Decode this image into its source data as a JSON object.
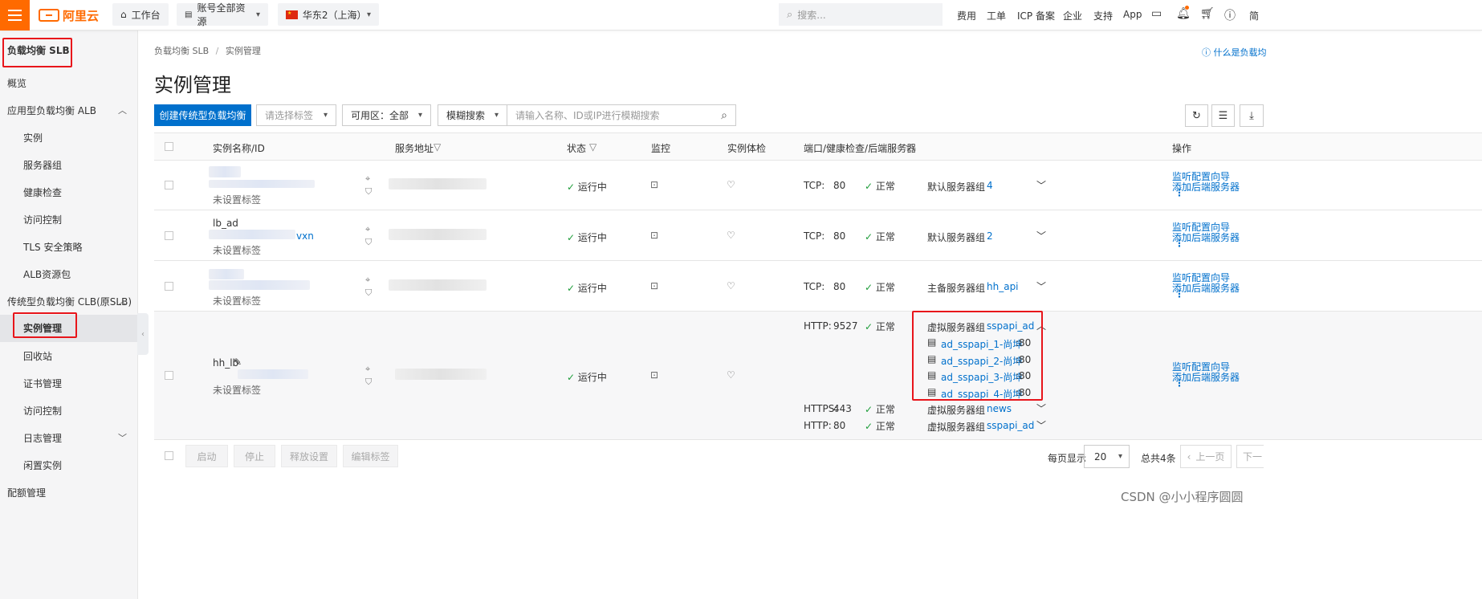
{
  "topbar": {
    "logo_text": "阿里云",
    "workbench": "工作台",
    "account_resources": "账号全部资源",
    "region": "华东2（上海）",
    "search_placeholder": "搜索...",
    "links": [
      "费用",
      "工单",
      "ICP 备案",
      "企业",
      "支持",
      "App"
    ],
    "lang": "简"
  },
  "sidebar": {
    "title": "负载均衡 SLB",
    "items": [
      {
        "label": "概览",
        "kind": "group"
      },
      {
        "label": "应用型负载均衡 ALB",
        "kind": "group",
        "chevron": "^"
      },
      {
        "label": "实例",
        "kind": "sub"
      },
      {
        "label": "服务器组",
        "kind": "sub"
      },
      {
        "label": "健康检查",
        "kind": "sub"
      },
      {
        "label": "访问控制",
        "kind": "sub"
      },
      {
        "label": "TLS 安全策略",
        "kind": "sub"
      },
      {
        "label": "ALB资源包",
        "kind": "sub"
      },
      {
        "label": "传统型负载均衡 CLB(原SLB)",
        "kind": "group",
        "chevron": "^"
      },
      {
        "label": "实例管理",
        "kind": "sub",
        "active": true
      },
      {
        "label": "回收站",
        "kind": "sub"
      },
      {
        "label": "证书管理",
        "kind": "sub"
      },
      {
        "label": "访问控制",
        "kind": "sub"
      },
      {
        "label": "日志管理",
        "kind": "sub",
        "chevron": "v"
      },
      {
        "label": "闲置实例",
        "kind": "sub"
      },
      {
        "label": "配额管理",
        "kind": "group"
      }
    ]
  },
  "main": {
    "breadcrumb_root": "负载均衡 SLB",
    "breadcrumb_sep": "/",
    "breadcrumb_current": "实例管理",
    "help_link": "什么是负载均",
    "page_title": "实例管理",
    "create_button": "创建传统型负载均衡",
    "tag_select_placeholder": "请选择标签",
    "zone_select": "可用区：全部",
    "search_mode": "模糊搜索",
    "search_placeholder": "请输入名称、ID或IP进行模糊搜索"
  },
  "table": {
    "headers": {
      "name": "实例名称/ID",
      "address": "服务地址",
      "status": "状态",
      "monitor": "监控",
      "health": "实例体检",
      "ports": "端口/健康检查/后端服务器",
      "actions": "操作"
    },
    "rows": [
      {
        "name": "",
        "name_suffix": "",
        "tag": "未设置标签",
        "status": "运行中",
        "listeners": [
          {
            "protocol": "TCP:",
            "port": "80",
            "health": "正常",
            "group_type": "默认服务器组",
            "group": "4"
          }
        ],
        "actions": [
          "监听配置向导",
          "添加后端服务器"
        ]
      },
      {
        "name": "lb_ad",
        "name_suffix": "vxn",
        "tag": "未设置标签",
        "status": "运行中",
        "listeners": [
          {
            "protocol": "TCP:",
            "port": "80",
            "health": "正常",
            "group_type": "默认服务器组",
            "group": "2"
          }
        ],
        "actions": [
          "监听配置向导",
          "添加后端服务器"
        ]
      },
      {
        "name": "",
        "name_suffix": "",
        "tag": "未设置标签",
        "status": "运行中",
        "listeners": [
          {
            "protocol": "TCP:",
            "port": "80",
            "health": "正常",
            "group_type": "主备服务器组",
            "group": "hh_api"
          }
        ],
        "actions": [
          "监听配置向导",
          "添加后端服务器"
        ]
      },
      {
        "name": "hh_lb",
        "name_suffix": "",
        "tag": "未设置标签",
        "status": "运行中",
        "listeners": [
          {
            "protocol": "HTTP:",
            "port": "9527",
            "health": "正常",
            "group_type": "虚拟服务器组",
            "group": "sspapi_ad",
            "servers": [
              {
                "name": "ad_sspapi_1-尚坤",
                "port": ":80"
              },
              {
                "name": "ad_sspapi_2-尚坤",
                "port": ":80"
              },
              {
                "name": "ad_sspapi_3-尚坤",
                "port": ":80"
              },
              {
                "name": "ad_sspapi_4-尚坤",
                "port": ":80"
              }
            ]
          },
          {
            "protocol": "HTTPS:",
            "port": "443",
            "health": "正常",
            "group_type": "虚拟服务器组",
            "group": "news"
          },
          {
            "protocol": "HTTP:",
            "port": "80",
            "health": "正常",
            "group_type": "虚拟服务器组",
            "group": "sspapi_ad"
          }
        ],
        "actions": [
          "监听配置向导",
          "添加后端服务器"
        ]
      }
    ]
  },
  "footer": {
    "bulk_buttons": [
      "启动",
      "停止",
      "释放设置",
      "编辑标签"
    ],
    "per_page_label": "每页显示",
    "per_page_value": "20",
    "total": "总共4条",
    "prev": "上一页",
    "next": "下一"
  },
  "watermark": "CSDN @小小程序圆圆",
  "colors": {
    "brand": "#ff6a00",
    "primary": "#0070cc",
    "ok": "#1e9d3a",
    "highlight": "#e8151b"
  }
}
